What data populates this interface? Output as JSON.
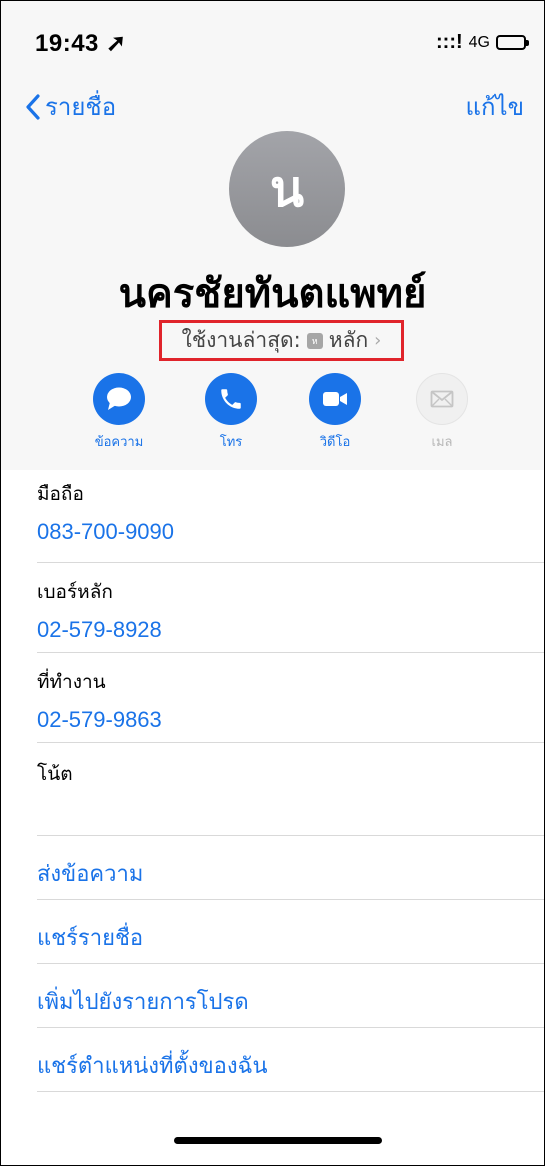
{
  "status_bar": {
    "time": "19:43 ➚",
    "signal": ":::!",
    "network": "4G"
  },
  "nav": {
    "back_label": "รายชื่อ",
    "edit_label": "แก้ไข"
  },
  "contact": {
    "avatar_initial": "น",
    "name": "นครชัยทันตแพทย์",
    "recent_prefix": "ใช้งานล่าสุด:",
    "recent_tag": "ห",
    "recent_label": "หลัก"
  },
  "actions": [
    {
      "label": "ข้อความ",
      "icon": "message-icon",
      "enabled": true
    },
    {
      "label": "โทร",
      "icon": "phone-icon",
      "enabled": true
    },
    {
      "label": "วิดีโอ",
      "icon": "video-icon",
      "enabled": true
    },
    {
      "label": "เมล",
      "icon": "mail-icon",
      "enabled": false
    }
  ],
  "fields": [
    {
      "label": "มือถือ",
      "value": "083-700-9090"
    },
    {
      "label": "เบอร์หลัก",
      "value": "02-579-8928"
    },
    {
      "label": "ที่ทำงาน",
      "value": "02-579-9863"
    }
  ],
  "notes": {
    "label": "โน้ต"
  },
  "links": [
    {
      "label": "ส่งข้อความ"
    },
    {
      "label": "แชร์รายชื่อ"
    },
    {
      "label": "เพิ่มไปยังรายการโปรด"
    },
    {
      "label": "แชร์ตำแหน่งที่ตั้งของฉัน"
    }
  ],
  "colors": {
    "accent": "#1a73e8",
    "highlight_box": "#e0242b",
    "avatar": "#9a9b9f"
  }
}
